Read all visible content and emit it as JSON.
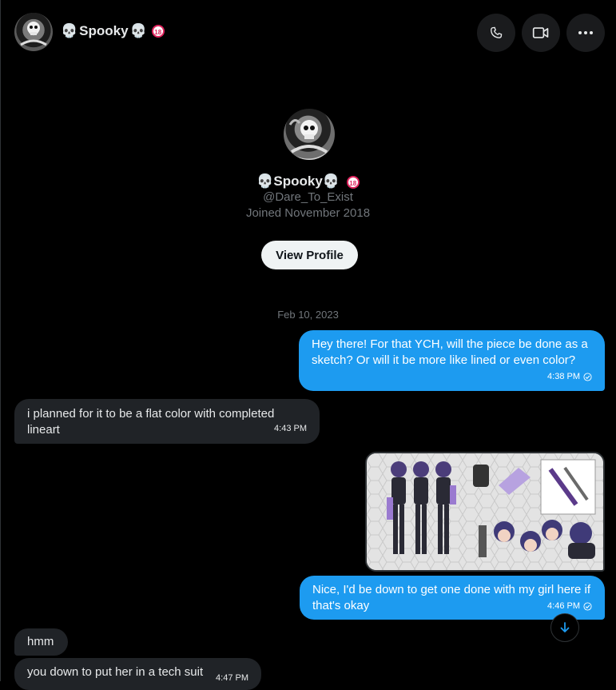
{
  "header": {
    "name": "Spooky",
    "name_prefix_emoji": "💀",
    "name_suffix_emoji": "💀",
    "age_badge": "18",
    "call_icon": "phone-icon",
    "video_icon": "video-icon",
    "more_icon": "more-icon"
  },
  "profile": {
    "name": "Spooky",
    "handle": "@Dare_To_Exist",
    "joined": "Joined November 2018",
    "view_profile_label": "View Profile"
  },
  "conversation": {
    "date_divider": "Feb 10, 2023",
    "messages": [
      {
        "direction": "outgoing",
        "text": "Hey there! For that YCH, will the piece be done as a sketch? Or will it be more like lined or even color?",
        "time": "4:38 PM"
      },
      {
        "direction": "incoming",
        "text": "i planned for it to be a flat color with completed lineart",
        "time": "4:43 PM"
      },
      {
        "direction": "outgoing",
        "type": "image"
      },
      {
        "direction": "outgoing",
        "text": "Nice, I'd be down to get one done with my girl here if that's okay",
        "time": "4:46 PM"
      },
      {
        "direction": "incoming",
        "text": "hmm"
      },
      {
        "direction": "incoming",
        "text": "you down to put her in a tech suit",
        "time": "4:47 PM"
      }
    ]
  },
  "colors": {
    "accent": "#1d9bf0",
    "incoming_bubble": "#202327",
    "muted_text": "#71767b",
    "background": "#000000"
  }
}
